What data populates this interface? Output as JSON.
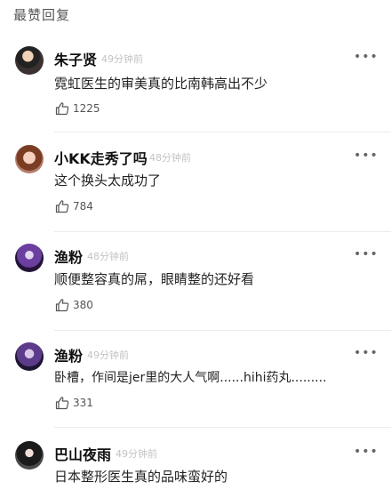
{
  "section_title": "最赞回复",
  "comments": [
    {
      "username": "朱子贤",
      "time": "49分钟前",
      "text": "霓虹医生的审美真的比南韩高出不少",
      "likes": "1225"
    },
    {
      "username": "小KK走秀了吗",
      "time": "48分钟前",
      "text": "这个换头太成功了",
      "likes": "784"
    },
    {
      "username": "渔粉",
      "time": "48分钟前",
      "text": "顺便整容真的屌，眼睛整的还好看",
      "likes": "380"
    },
    {
      "username": "渔粉",
      "time": "49分钟前",
      "text": "卧槽，作间是jer里的大人气啊......hihi药丸.........",
      "likes": "331"
    },
    {
      "username": "巴山夜雨",
      "time": "49分钟前",
      "text": "日本整形医生真的品味蛮好的",
      "likes": ""
    }
  ],
  "more_glyph": "•••"
}
